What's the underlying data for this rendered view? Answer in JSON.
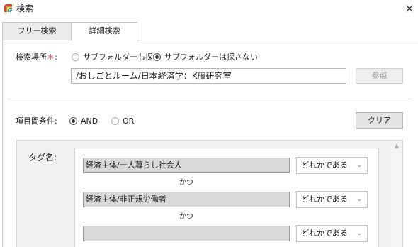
{
  "window": {
    "title": "検索",
    "close_symbol": "×"
  },
  "tabs": [
    {
      "label": "フリー検索",
      "active": false
    },
    {
      "label": "詳細検索",
      "active": true
    }
  ],
  "location": {
    "label": "検索場所",
    "required_mark": "＊",
    "colon": ":",
    "option_include": "サブフォルダーも探す",
    "option_exclude": "サブフォルダーは探さない",
    "selected": "option_exclude",
    "path_value": "/おしごとルーム/日本経済学：K藤研究室",
    "browse_label": "参照"
  },
  "condition": {
    "label": "項目間条件:",
    "option_and": "AND",
    "option_or": "OR",
    "selected": "option_and",
    "clear_label": "クリア"
  },
  "tags": {
    "label": "タグ名:",
    "rows": [
      {
        "value": "経済主体/一人暮らし社会人",
        "match": "どれかである"
      },
      {
        "value": "経済主体/非正規労働者",
        "match": "どれかである"
      },
      {
        "value": "",
        "match": "どれかである"
      }
    ],
    "conjunction": "かつ"
  },
  "colors": {
    "required": "#e8384f",
    "field_gray": "#d9d9d9",
    "panel_gray": "#f0f0f0"
  }
}
